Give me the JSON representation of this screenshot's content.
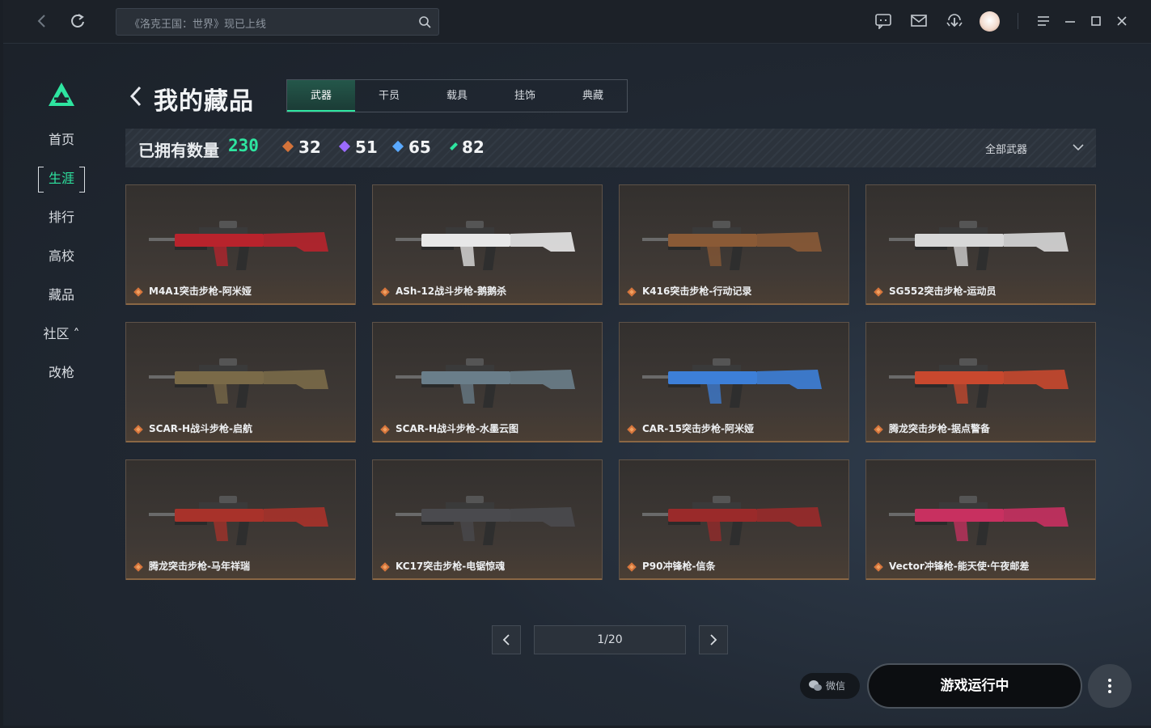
{
  "topbar": {
    "search_placeholder": "《洛克王国：世界》现已上线"
  },
  "sidebar": {
    "items": [
      {
        "label": "首页"
      },
      {
        "label": "生涯"
      },
      {
        "label": "排行"
      },
      {
        "label": "高校"
      },
      {
        "label": "藏品"
      },
      {
        "label": "社区 ˄"
      },
      {
        "label": "改枪"
      }
    ],
    "active_index": 1
  },
  "header": {
    "title": "我的藏品",
    "tabs": [
      "武器",
      "干员",
      "载具",
      "挂饰",
      "典藏"
    ],
    "active_tab": 0
  },
  "stats": {
    "owned_label": "已拥有数量",
    "owned_count": "230",
    "counts": [
      {
        "value": "32",
        "color": "#d4733a"
      },
      {
        "value": "51",
        "color": "#9b6bff"
      },
      {
        "value": "65",
        "color": "#5aa9ff"
      },
      {
        "value": "82",
        "color": "#2ee5a0"
      }
    ],
    "filter_label": "全部武器"
  },
  "cards": [
    {
      "name": "M4A1突击步枪-阿米娅",
      "accent": "#b8232c"
    },
    {
      "name": "ASh-12战斗步枪-鹅鹅杀",
      "accent": "#e8e8e8"
    },
    {
      "name": "K416突击步枪-行动记录",
      "accent": "#8a5a36"
    },
    {
      "name": "SG552突击步枪-运动员",
      "accent": "#d8d8d8"
    },
    {
      "name": "SCAR-H战斗步枪-启航",
      "accent": "#7a6a48"
    },
    {
      "name": "SCAR-H战斗步枪-水墨云图",
      "accent": "#6a7e8a"
    },
    {
      "name": "CAR-15突击步枪-阿米娅",
      "accent": "#3d7fd8"
    },
    {
      "name": "腾龙突击步枪-据点警备",
      "accent": "#c8482e"
    },
    {
      "name": "腾龙突击步枪-马年祥瑞",
      "accent": "#a8322a"
    },
    {
      "name": "KC17突击步枪-电锯惊魂",
      "accent": "#4a4a4e"
    },
    {
      "name": "P90冲锋枪-信条",
      "accent": "#9a2a2a"
    },
    {
      "name": "Vector冲锋枪-能天使·午夜邮差",
      "accent": "#c83060"
    }
  ],
  "pagination": {
    "indicator": "1/20"
  },
  "footer": {
    "wechat_label": "微信",
    "launch_label": "游戏运行中"
  }
}
